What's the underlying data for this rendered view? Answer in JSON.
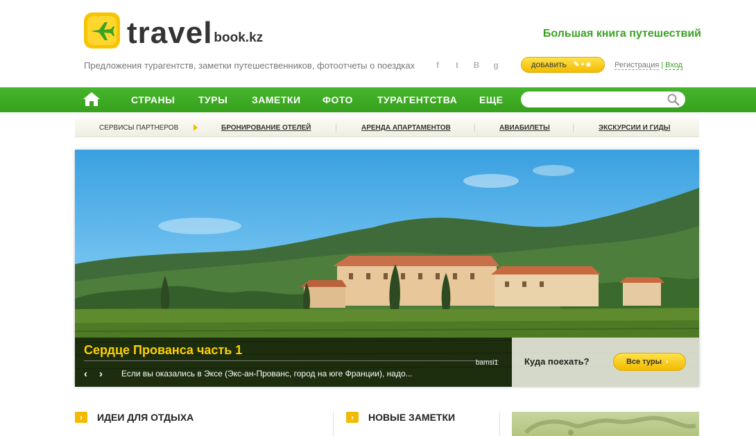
{
  "header": {
    "logo_main": "travel",
    "logo_sub": "book.kz",
    "tagline": "Предложения турагентств, заметки путешественников, фотоотчеты о поездках",
    "slogan": "Большая книга путешествий",
    "social": [
      "f",
      "t",
      "B",
      "g"
    ],
    "add_label": "ДОБАВИТЬ",
    "register_label": "Регистрация",
    "auth_separator": "|",
    "login_label": "Вход"
  },
  "nav": {
    "items": [
      "СТРАНЫ",
      "ТУРЫ",
      "ЗАМЕТКИ",
      "ФОТО",
      "ТУРАГЕНТСТВА",
      "ЕЩЕ"
    ],
    "search_placeholder": ""
  },
  "partners": {
    "label": "СЕРВИСЫ ПАРТНЕРОВ",
    "links": [
      "БРОНИРОВАНИЕ ОТЕЛЕЙ",
      "АРЕНДА АПАРТАМЕНТОВ",
      "АВИАБИЛЕТЫ",
      "ЭКСКУРСИИ И ГИДЫ"
    ]
  },
  "hero": {
    "title": "Сердце Прованса часть 1",
    "author": "bamsi1",
    "excerpt": "Если вы оказались в Эксе (Экс-ан-Прованс, город на юге Франции), надо...",
    "where_question": "Куда поехать?",
    "all_tours_label": "Все туры"
  },
  "sections": {
    "ideas": "ИДЕИ ДЛЯ ОТДЫХА",
    "notes": "НОВЫЕ ЗАМЕТКИ"
  },
  "colors": {
    "brand_green": "#3aa223",
    "accent_yellow": "#f3bb00"
  }
}
